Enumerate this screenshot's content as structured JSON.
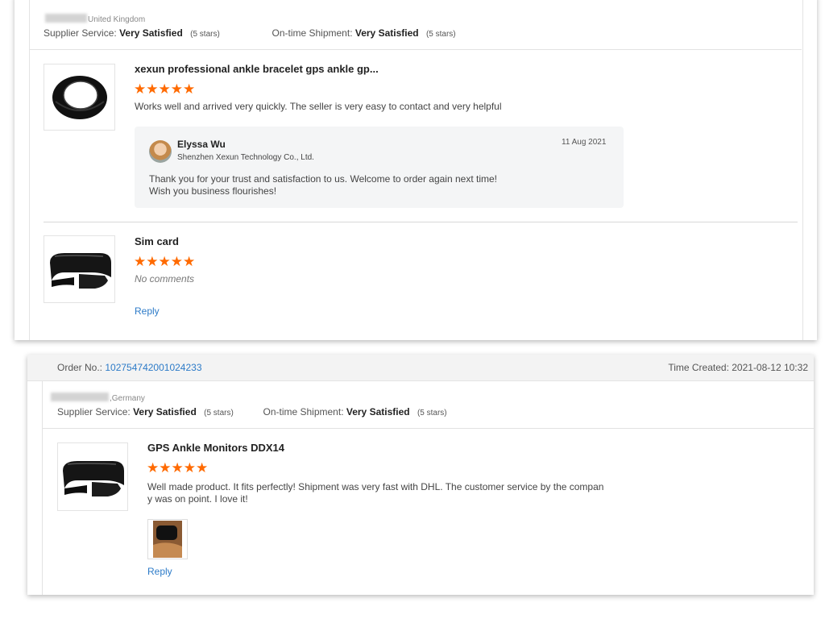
{
  "colors": {
    "star": "#ff6a00",
    "link": "#2d7bc8"
  },
  "icons": {
    "star": "star-icon",
    "ring_product": "ring-bracelet-image",
    "clip_product": "ankle-monitor-image"
  },
  "review1": {
    "country": "United Kingdom",
    "supplier_service_label": "Supplier Service:",
    "supplier_service_value": "Very Satisfied",
    "supplier_service_stars": "(5 stars)",
    "shipment_label": "On-time Shipment:",
    "shipment_value": "Very Satisfied",
    "shipment_stars": "(5 stars)",
    "items": [
      {
        "title": "xexun professional ankle bracelet gps ankle gp...",
        "stars": "★★★★★",
        "rating": 5,
        "comment": "Works well and arrived very quickly. The seller is very easy to contact and very helpful",
        "seller_reply": {
          "name": "Elyssa Wu",
          "company": "Shenzhen Xexun Technology Co., Ltd.",
          "date": "11 Aug 2021",
          "line1": "Thank you for your trust and satisfaction to us. Welcome to order again next time!",
          "line2": "Wish you business flourishes!"
        }
      },
      {
        "title": "Sim card",
        "stars": "★★★★★",
        "rating": 5,
        "comment": "No comments",
        "reply_label": "Reply"
      }
    ]
  },
  "review2": {
    "order_label": "Order No.:",
    "order_number": "102754742001024233",
    "time_created": "Time Created: 2021-08-12 10:32",
    "country": ",Germany",
    "supplier_service_label": "Supplier Service:",
    "supplier_service_value": "Very Satisfied",
    "supplier_service_stars": "(5 stars)",
    "shipment_label": "On-time Shipment:",
    "shipment_value": "Very Satisfied",
    "shipment_stars": "(5 stars)",
    "item": {
      "title": "GPS Ankle Monitors DDX14",
      "stars": "★★★★★",
      "rating": 5,
      "comment_line1": "Well made product. It fits perfectly! Shipment was very fast with DHL. The customer service by the compan",
      "comment_line2": "y was on point. I love it!",
      "reply_label": "Reply"
    }
  }
}
